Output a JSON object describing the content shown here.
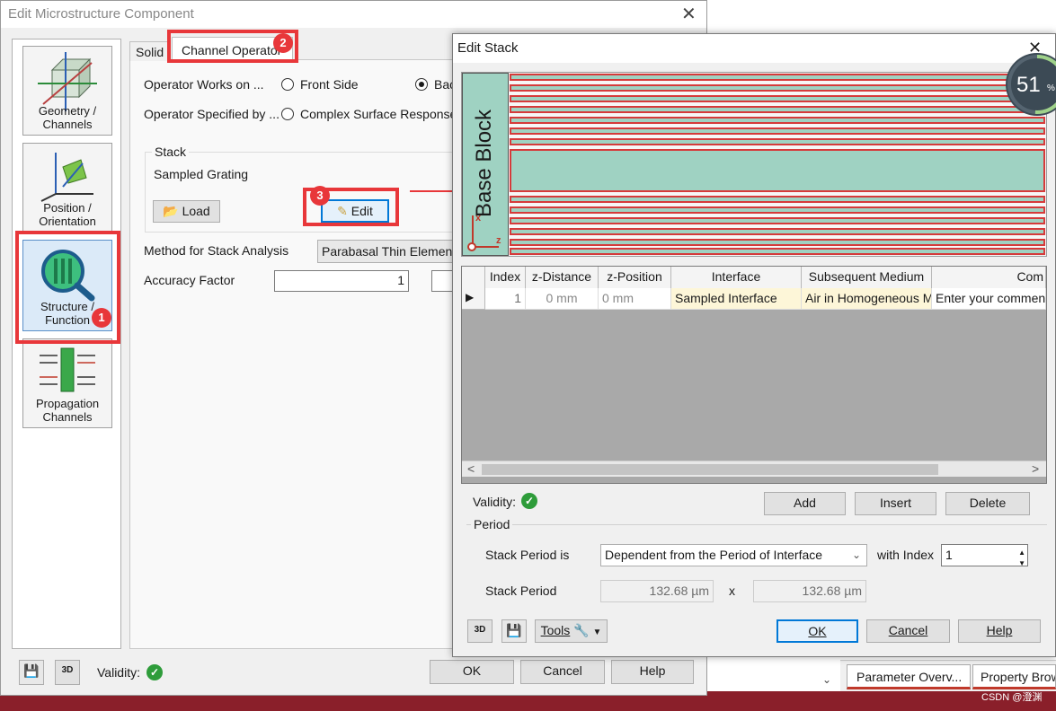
{
  "main_window": {
    "title": "Edit Microstructure Component",
    "nav": {
      "geometry": "Geometry /\nChannels",
      "position": "Position /\nOrientation",
      "structure": "Structure /\nFunction",
      "propagation": "Propagation\nChannels"
    },
    "tabs": [
      "Solid",
      "Channel Operator"
    ],
    "operator_works_on_label": "Operator Works on ...",
    "front_side": "Front Side",
    "back_side_partial": "Bac",
    "operator_specified_by_label": "Operator Specified by ...",
    "complex_surface_response": "Complex Surface Response",
    "stack_group": "Stack",
    "stack_name": "Sampled Grating",
    "load": "Load",
    "edit": "Edit",
    "method_label": "Method for Stack Analysis",
    "method_value": "Parabasal Thin Element A",
    "accuracy_label": "Accuracy Factor",
    "accuracy_value": "1",
    "validity": "Validity:",
    "ok": "OK",
    "cancel": "Cancel",
    "help": "Help"
  },
  "annotations": [
    "1",
    "2",
    "3"
  ],
  "edit_stack": {
    "title": "Edit Stack",
    "base_block": "Base Block",
    "axis_x": "x",
    "axis_z": "z",
    "progress_text": "51",
    "progress_unit": "%",
    "progress_value": 0.51,
    "table": {
      "columns": [
        "Index",
        "z-Distance",
        "z-Position",
        "Interface",
        "Subsequent Medium",
        "Com"
      ],
      "rows": [
        {
          "index": "1",
          "z_distance": "0 mm",
          "z_position": "0 mm",
          "interface": "Sampled Interface",
          "medium": "Air in Homogeneous M",
          "comment": "Enter your comment"
        }
      ]
    },
    "validity": "Validity:",
    "add": "Add",
    "insert": "Insert",
    "delete": "Delete",
    "period_group": "Period",
    "stack_period_is_label": "Stack Period is",
    "stack_period_is_value": "Dependent from the Period of Interface",
    "with_index_label": "with Index",
    "with_index_value": "1",
    "stack_period_label": "Stack Period",
    "period_x": "132.68 µm",
    "period_times": "x",
    "period_y": "132.68 µm",
    "tools": "Tools",
    "ok": "OK",
    "cancel": "Cancel",
    "help": "Help"
  },
  "background": {
    "tab_parameter": "Parameter Overv...",
    "tab_property": "Property Brow",
    "watermark": "CSDN @澄渊"
  },
  "colors": {
    "annotation_red": "#e8373a",
    "stack_teal": "#9fd2c2",
    "validity_green": "#2e9c3a",
    "focus_blue": "#0078d7"
  }
}
